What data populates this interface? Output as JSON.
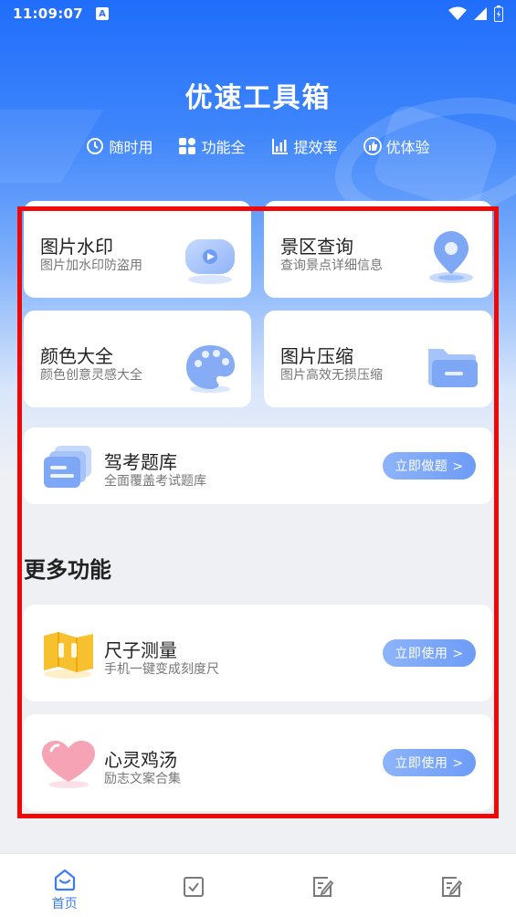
{
  "status_bar": {
    "time": "11:09:07",
    "badge": "A"
  },
  "header": {
    "title": "优速工具箱",
    "features": [
      {
        "icon": "clock-icon",
        "label": "随时用"
      },
      {
        "icon": "grid-icon",
        "label": "功能全"
      },
      {
        "icon": "bar-chart-icon",
        "label": "提效率"
      },
      {
        "icon": "thumbs-up-icon",
        "label": "优体验"
      }
    ]
  },
  "tools": {
    "watermark": {
      "title": "图片水印",
      "subtitle": "图片加水印防盗用",
      "icon": "video-bubble-icon"
    },
    "scenic": {
      "title": "景区查询",
      "subtitle": "查询景点详细信息",
      "icon": "location-pin-icon"
    },
    "colors": {
      "title": "颜色大全",
      "subtitle": "颜色创意灵感大全",
      "icon": "palette-icon"
    },
    "compress": {
      "title": "图片压缩",
      "subtitle": "图片高效无损压缩",
      "icon": "folder-icon"
    },
    "exam": {
      "title": "驾考题库",
      "subtitle": "全面覆盖考试题库",
      "icon": "cards-icon",
      "button": "立即做题 >"
    }
  },
  "more": {
    "title": "更多功能",
    "ruler": {
      "title": "尺子测量",
      "subtitle": "手机一键变成刻度尺",
      "icon": "ruler-map-icon",
      "button": "立即使用 >"
    },
    "soup": {
      "title": "心灵鸡汤",
      "subtitle": "励志文案合集",
      "icon": "heart-icon",
      "button": "立即使用 >"
    }
  },
  "tabbar": {
    "home": {
      "label": "首页",
      "icon": "home-icon"
    },
    "tab2": {
      "icon": "checkbox-icon"
    },
    "tab3": {
      "icon": "edit-document-icon"
    },
    "tab4": {
      "icon": "edit-document-icon"
    }
  },
  "colors": {
    "accent": "#3b7bfb",
    "highlight": "#f00806",
    "button": "#7aa6f8"
  }
}
